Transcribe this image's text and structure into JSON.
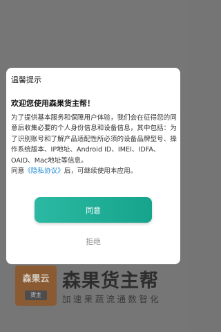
{
  "background": {
    "brand_logo_text": "森果云",
    "brand_logo_sub": "货主",
    "brand_name": "森果货主帮",
    "brand_slogan": "加速果蔬流通数智化"
  },
  "dialog": {
    "title": "温馨提示",
    "heading": "欢迎您使用森果货主帮！",
    "body_paragraph": "为了提供基本服务和保障用户体验，我们会在征得您的同意后收集必要的个人身份信息和设备信息，其中包括：为了识别账号和了解产品适配性所必须的设备品牌型号、操作系统版本、IP地址、Android ID、IMEI、IDFA、OAID、Mac地址等信息。",
    "consent_prefix": "同意",
    "privacy_link": "《隐私协议》",
    "consent_suffix": "后，可继续使用本应用。",
    "agree_label": "同意",
    "reject_label": "拒绝"
  },
  "colors": {
    "overlay": "#767676",
    "accent": "#1aa88f",
    "link": "#1e8ad6"
  }
}
